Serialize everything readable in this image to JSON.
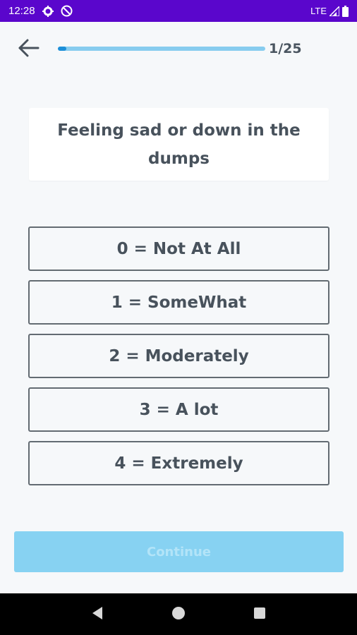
{
  "status_bar": {
    "time": "12:28",
    "network": "LTE",
    "icons": [
      "settings-gear-icon",
      "do-not-disturb-icon",
      "signal-icon",
      "battery-icon"
    ]
  },
  "header": {
    "back_icon": "arrow-left-icon",
    "progress": {
      "current": 1,
      "total": 25,
      "fraction": 0.04,
      "label": "1/25"
    }
  },
  "question": {
    "text": "Feeling sad or down in the dumps"
  },
  "options": [
    {
      "label": "0 = Not At All"
    },
    {
      "label": "1 = SomeWhat"
    },
    {
      "label": "2 = Moderately"
    },
    {
      "label": "3 = A lot"
    },
    {
      "label": "4 = Extremely"
    }
  ],
  "continue_button": {
    "label": "Continue",
    "state": "disabled"
  },
  "nav_bar": {
    "icons": [
      "back-triangle-icon",
      "home-circle-icon",
      "recents-square-icon"
    ]
  },
  "colors": {
    "status_bar_bg": "#5a06cc",
    "progress_track": "#87ccef",
    "progress_fill": "#1d8fd8",
    "text": "#48525c",
    "option_border": "#636b72",
    "continue_bg": "#87d2f2",
    "continue_text": "#b3e4f8",
    "background": "#f6f8fa"
  }
}
